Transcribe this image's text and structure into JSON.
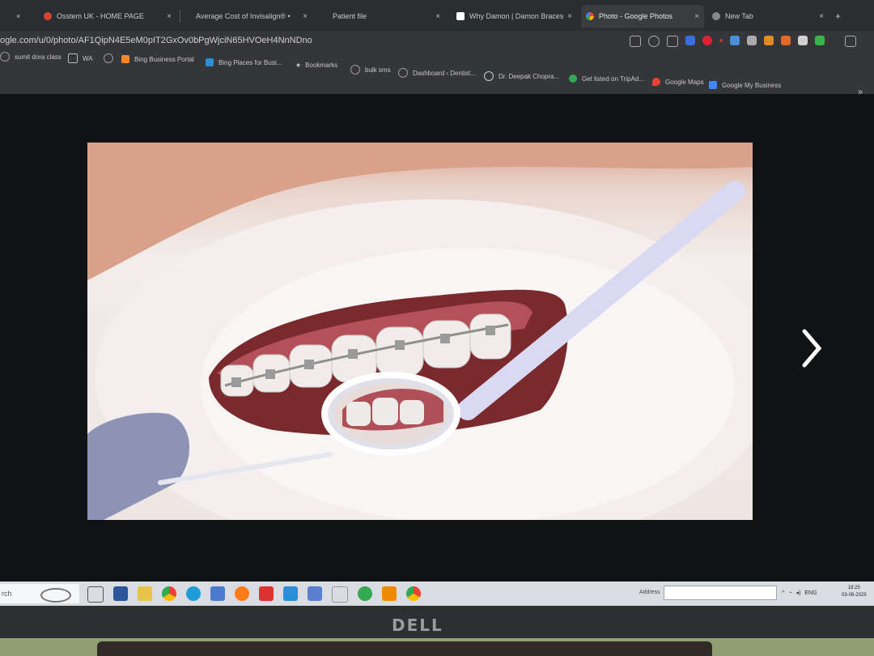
{
  "tabs": [
    {
      "label": "Osstem UK - HOME PAGE",
      "fav_color": "#d8432f"
    },
    {
      "label": "Average Cost of Invisalign® •",
      "fav_color": "#555"
    },
    {
      "label": "Patient file",
      "fav_color": "#777"
    },
    {
      "label": "Why Damon | Damon Braces",
      "fav_color": "#ffffff"
    },
    {
      "label": "Photo - Google Photos",
      "fav_color": "#e8a33c"
    },
    {
      "label": "New Tab",
      "fav_color": "#888"
    }
  ],
  "close_glyph": "×",
  "new_tab_glyph": "+",
  "url": "ogle.com/u/0/photo/AF1QipN4E5eM0pIT2GxOv0bPgWjciN65HVOeH4NnNDno",
  "bookmarks": [
    "sumit dora class",
    "WA",
    "",
    "Bing Business Portal",
    "Bing Places for Busi...",
    "Bookmarks",
    "bulk sms",
    "Dashboard ‹ Dentist...",
    "Dr. Deepak Chopra...",
    "Get listed on TripAd...",
    "Google Maps",
    "Google My Business"
  ],
  "bookmarks_more": "»",
  "taskbar": {
    "search_text": "rch",
    "address_label": "Address",
    "lang": "ENG",
    "time": "18:25",
    "date": "03-08-2025"
  },
  "brand": "DELL",
  "colors": {
    "chrome_dark": "#2b2d30",
    "toolbar": "#35363a",
    "taskbar": "#d9dde2",
    "viewer_bg": "#101213"
  }
}
